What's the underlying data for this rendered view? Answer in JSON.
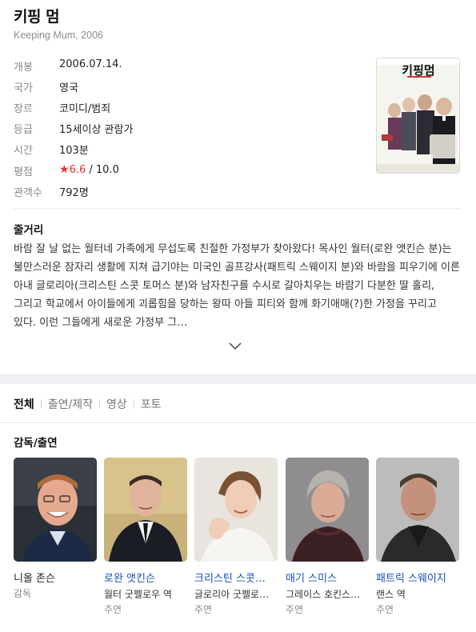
{
  "movie": {
    "title": "키핑 멈",
    "subtitle": "Keeping Mum, 2006",
    "info": [
      {
        "label": "개봉",
        "value": "2006.07.14."
      },
      {
        "label": "국가",
        "value": "영국"
      },
      {
        "label": "장르",
        "value": "코미디/범죄"
      },
      {
        "label": "등급",
        "value": "15세이상 관람가"
      },
      {
        "label": "시간",
        "value": "103분"
      },
      {
        "label": "평점",
        "value": ""
      },
      {
        "label": "관객수",
        "value": "792명"
      }
    ],
    "rating": {
      "star": "★",
      "score": "6.6",
      "max": " / 10.0"
    },
    "poster": {
      "title_text": "키핑멈"
    }
  },
  "synopsis": {
    "heading": "줄거리",
    "text": "바람 잘 날 없는 월터네 가족에게 무섭도록 친절한 가정부가 찾아왔다! 목사인 월터(로완 앳킨슨 분)는 불만스러운 잠자리 생활에 지쳐 급기야는 미국인 골프강사(패트릭 스웨이지 분)와 바람을 피우기에 이른 아내 글로리아(크리스틴 스콧 토머스 분)와 남자친구를 수시로 갈아치우는 바람기 다분한 딸 홀리, 그리고 학교에서 아이들에게 괴롭힘을 당하는 왕따 아들 피티와 함께 화기애매(?)한 가정을 꾸리고 있다. 이런 그들에게 새로운 가정부 그…"
  },
  "tabs": [
    {
      "label": "전체",
      "active": true
    },
    {
      "label": "출연/제작",
      "active": false
    },
    {
      "label": "영상",
      "active": false
    },
    {
      "label": "포토",
      "active": false
    }
  ],
  "cast": {
    "heading": "감독/출연",
    "people": [
      {
        "name": "니올 존슨",
        "role": "",
        "type": "감독",
        "link": false
      },
      {
        "name": "로완 앳킨슨",
        "role": "월터 굿펠로우 역",
        "type": "주연",
        "link": true
      },
      {
        "name": "크리스틴 스콧…",
        "role": "글로리아 굿펠로…",
        "type": "주연",
        "link": true
      },
      {
        "name": "매기 스미스",
        "role": "그레이스 호킨스…",
        "type": "주연",
        "link": true
      },
      {
        "name": "패트릭 스웨이지",
        "role": "랜스 역",
        "type": "주연",
        "link": true
      }
    ]
  }
}
